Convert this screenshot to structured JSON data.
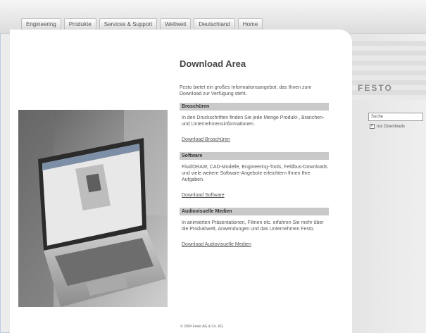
{
  "nav": {
    "items": [
      "Engineering",
      "Produkte",
      "Services & Support",
      "Weltweit",
      "Deutschland",
      "Home"
    ]
  },
  "brand": {
    "logo_text": "FESTO"
  },
  "search": {
    "value": "Suche",
    "checkbox_label": "nur Downloads",
    "checked": true
  },
  "main": {
    "title": "Download Area",
    "intro": "Festo bietet ein großes Informationsangebot, das Ihnen zum Download zur Verfügung steht.",
    "sections": [
      {
        "heading": "Broschüren",
        "text": "In den Druckschriften finden Sie jede Menge Produkt-, Branchen- und Unternehmensinformationen.",
        "link": "Download Broschüren"
      },
      {
        "heading": "Software",
        "text": "FluidDRAW, CAD-Modelle, Engineering-Tools, Feldbus-Downloads und viele weitere Software-Angebote erleichtern Ihnen Ihre Aufgaben.",
        "link": "Download Software"
      },
      {
        "heading": "Audiovisuelle Medien",
        "text": "In animierten Präsentationen, Filmen etc. erfahren Sie mehr über die Produktwelt, Anwendungen und das Unternehmen Festo.",
        "link": "Download Audiovisuelle Medien"
      }
    ]
  },
  "footer": {
    "copyright": "© 2004 Festo AG & Co. KG"
  },
  "colors": {
    "frame_accent": "#9fb7d6",
    "section_header_bg": "#c9c9c9"
  }
}
